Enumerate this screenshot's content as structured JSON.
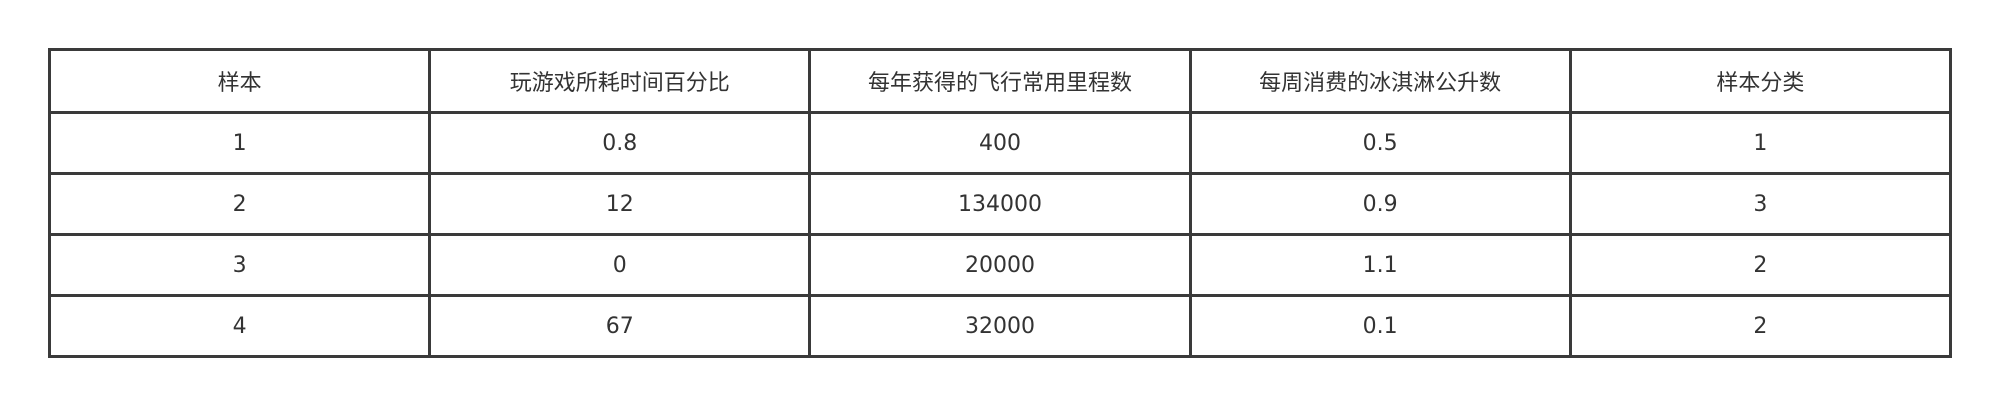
{
  "table": {
    "headers": [
      "样本",
      "玩游戏所耗时间百分比",
      "每年获得的飞行常用里程数",
      "每周消费的冰淇淋公升数",
      "样本分类"
    ],
    "rows": [
      [
        "1",
        "0.8",
        "400",
        "0.5",
        "1"
      ],
      [
        "2",
        "12",
        "134000",
        "0.9",
        "3"
      ],
      [
        "3",
        "0",
        "20000",
        "1.1",
        "2"
      ],
      [
        "4",
        "67",
        "32000",
        "0.1",
        "2"
      ]
    ]
  }
}
